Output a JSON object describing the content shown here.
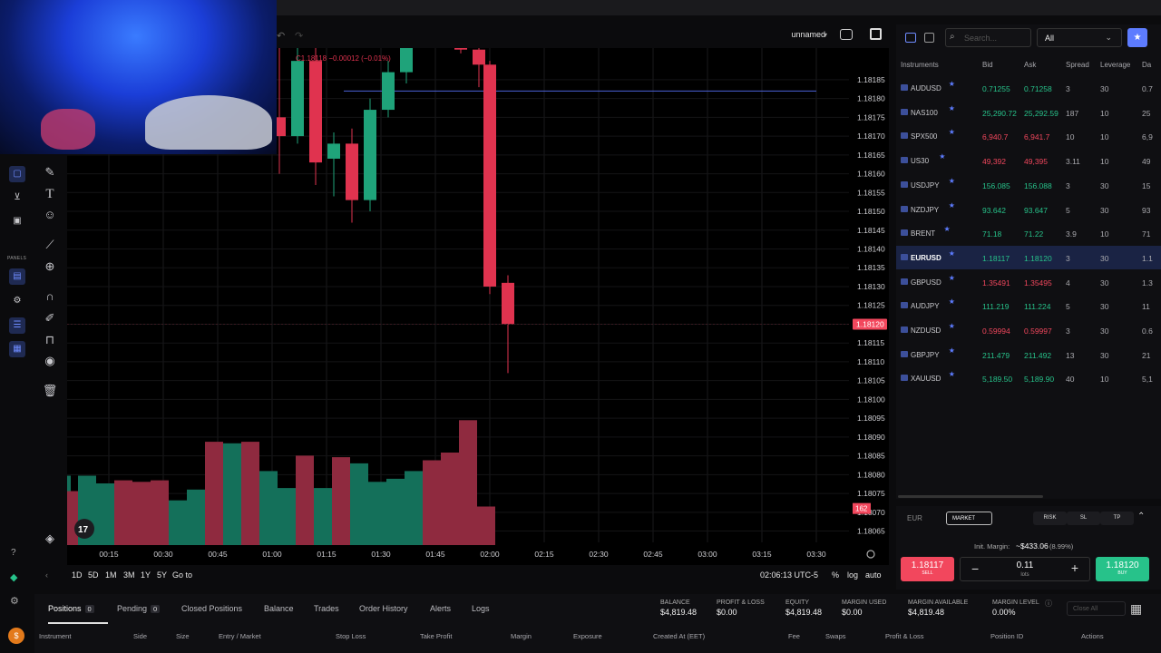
{
  "chart_header": {
    "name": "unnamed",
    "ohlc_text": "C1.18118 −0.00012 (−0.01%)"
  },
  "left_toolbar": {
    "panels_label": "PANELS"
  },
  "timeframes": [
    "1D",
    "5D",
    "1M",
    "3M",
    "1Y",
    "5Y",
    "Go to"
  ],
  "clock": "02:06:13 UTC-5",
  "chart_opts": {
    "percent": "%",
    "log": "log",
    "auto": "auto"
  },
  "chart_data": {
    "type": "candlestick",
    "symbol": "EURUSD",
    "x_ticks": [
      "00:15",
      "00:30",
      "00:45",
      "01:00",
      "01:15",
      "01:30",
      "01:45",
      "02:00",
      "02:15",
      "02:30",
      "02:45",
      "03:00",
      "03:15",
      "03:30"
    ],
    "y_ticks": [
      "1.18185",
      "1.18180",
      "1.18175",
      "1.18170",
      "1.18165",
      "1.18160",
      "1.18155",
      "1.18150",
      "1.18145",
      "1.18140",
      "1.18135",
      "1.18130",
      "1.18125",
      "1.18120",
      "1.18115",
      "1.18110",
      "1.18105",
      "1.18100",
      "1.18095",
      "1.18090",
      "1.18085",
      "1.18080",
      "1.18075",
      "1.18070",
      "1.18065"
    ],
    "ylim": [
      1.18062,
      1.18191
    ],
    "last_price": "1.18120",
    "countdown_label": "162",
    "horizontal_line": 1.18182,
    "candles": [
      {
        "t": "01:02",
        "o": 1.18175,
        "h": 1.18194,
        "l": 1.1816,
        "c": 1.1817
      },
      {
        "t": "01:07",
        "o": 1.1817,
        "h": 1.18194,
        "l": 1.18168,
        "c": 1.1819
      },
      {
        "t": "01:12",
        "o": 1.1819,
        "h": 1.18194,
        "l": 1.18157,
        "c": 1.18163
      },
      {
        "t": "01:17",
        "o": 1.18164,
        "h": 1.18171,
        "l": 1.18154,
        "c": 1.18168
      },
      {
        "t": "01:22",
        "o": 1.18168,
        "h": 1.18172,
        "l": 1.18147,
        "c": 1.18153
      },
      {
        "t": "01:27",
        "o": 1.18153,
        "h": 1.1818,
        "l": 1.1815,
        "c": 1.18177
      },
      {
        "t": "01:32",
        "o": 1.18177,
        "h": 1.1819,
        "l": 1.18175,
        "c": 1.18187
      },
      {
        "t": "01:37",
        "o": 1.18187,
        "h": 1.18198,
        "l": 1.18184,
        "c": 1.18194
      },
      {
        "t": "01:52",
        "o": 1.18194,
        "h": 1.18199,
        "l": 1.18192,
        "c": 1.18193
      },
      {
        "t": "01:57",
        "o": 1.18193,
        "h": 1.18196,
        "l": 1.18183,
        "c": 1.18189
      },
      {
        "t": "02:00",
        "o": 1.18189,
        "h": 1.1819,
        "l": 1.18128,
        "c": 1.1813
      },
      {
        "t": "02:05",
        "o": 1.18131,
        "h": 1.18133,
        "l": 1.18107,
        "c": 1.1812
      }
    ],
    "volume": [
      {
        "t": "00:00",
        "v": 0.45,
        "dir": "up"
      },
      {
        "t": "00:05",
        "v": 0.35,
        "dir": "down"
      },
      {
        "t": "00:10",
        "v": 0.45,
        "dir": "up"
      },
      {
        "t": "00:15",
        "v": 0.4,
        "dir": "up"
      },
      {
        "t": "00:20",
        "v": 0.42,
        "dir": "down"
      },
      {
        "t": "00:25",
        "v": 0.41,
        "dir": "down"
      },
      {
        "t": "00:30",
        "v": 0.42,
        "dir": "down"
      },
      {
        "t": "00:35",
        "v": 0.29,
        "dir": "up"
      },
      {
        "t": "00:40",
        "v": 0.36,
        "dir": "up"
      },
      {
        "t": "00:45",
        "v": 0.67,
        "dir": "down"
      },
      {
        "t": "00:50",
        "v": 0.66,
        "dir": "up"
      },
      {
        "t": "00:55",
        "v": 0.67,
        "dir": "down"
      },
      {
        "t": "01:00",
        "v": 0.48,
        "dir": "up"
      },
      {
        "t": "01:05",
        "v": 0.37,
        "dir": "up"
      },
      {
        "t": "01:10",
        "v": 0.58,
        "dir": "down"
      },
      {
        "t": "01:15",
        "v": 0.37,
        "dir": "up"
      },
      {
        "t": "01:20",
        "v": 0.57,
        "dir": "down"
      },
      {
        "t": "01:25",
        "v": 0.53,
        "dir": "up"
      },
      {
        "t": "01:30",
        "v": 0.41,
        "dir": "up"
      },
      {
        "t": "01:35",
        "v": 0.43,
        "dir": "up"
      },
      {
        "t": "01:40",
        "v": 0.48,
        "dir": "up"
      },
      {
        "t": "01:45",
        "v": 0.55,
        "dir": "down"
      },
      {
        "t": "01:50",
        "v": 0.6,
        "dir": "down"
      },
      {
        "t": "01:55",
        "v": 0.81,
        "dir": "down"
      },
      {
        "t": "02:00",
        "v": 0.25,
        "dir": "down"
      }
    ]
  },
  "instruments_panel": {
    "search_placeholder": "Search...",
    "filter_value": "All",
    "columns": [
      "Instruments",
      "Bid",
      "Ask",
      "Spread",
      "Leverage",
      "Da"
    ],
    "rows": [
      {
        "symbol": "AUDUSD",
        "bid": "0.71255",
        "ask": "0.71258",
        "spread": "3",
        "leverage": "30",
        "extra": "0.7",
        "color": "green"
      },
      {
        "symbol": "NAS100",
        "bid": "25,290.72",
        "ask": "25,292.59",
        "spread": "187",
        "leverage": "10",
        "extra": "25",
        "color": "green"
      },
      {
        "symbol": "SPX500",
        "bid": "6,940.7",
        "ask": "6,941.7",
        "spread": "10",
        "leverage": "10",
        "extra": "6,9",
        "color": "red"
      },
      {
        "symbol": "US30",
        "bid": "49,392",
        "ask": "49,395",
        "spread": "3.11",
        "leverage": "10",
        "extra": "49",
        "color": "red"
      },
      {
        "symbol": "USDJPY",
        "bid": "156.085",
        "ask": "156.088",
        "spread": "3",
        "leverage": "30",
        "extra": "15",
        "color": "green"
      },
      {
        "symbol": "NZDJPY",
        "bid": "93.642",
        "ask": "93.647",
        "spread": "5",
        "leverage": "30",
        "extra": "93",
        "color": "green"
      },
      {
        "symbol": "BRENT",
        "bid": "71.18",
        "ask": "71.22",
        "spread": "3.9",
        "leverage": "10",
        "extra": "71",
        "color": "green"
      },
      {
        "symbol": "EURUSD",
        "bid": "1.18117",
        "ask": "1.18120",
        "spread": "3",
        "leverage": "30",
        "extra": "1.1",
        "color": "green",
        "selected": true
      },
      {
        "symbol": "GBPUSD",
        "bid": "1.35491",
        "ask": "1.35495",
        "spread": "4",
        "leverage": "30",
        "extra": "1.3",
        "color": "red"
      },
      {
        "symbol": "AUDJPY",
        "bid": "111.219",
        "ask": "111.224",
        "spread": "5",
        "leverage": "30",
        "extra": "11",
        "color": "green"
      },
      {
        "symbol": "NZDUSD",
        "bid": "0.59994",
        "ask": "0.59997",
        "spread": "3",
        "leverage": "30",
        "extra": "0.6",
        "color": "red"
      },
      {
        "symbol": "GBPJPY",
        "bid": "211.479",
        "ask": "211.492",
        "spread": "13",
        "leverage": "30",
        "extra": "21",
        "color": "green"
      },
      {
        "symbol": "XAUUSD",
        "bid": "5,189.50",
        "ask": "5,189.90",
        "spread": "40",
        "leverage": "10",
        "extra": "5,1",
        "color": "green"
      }
    ]
  },
  "order_panel": {
    "symbol_short": "EUR",
    "market_label": "MARKET",
    "risk_label": "RISK",
    "sl_label": "SL",
    "tp_label": "TP",
    "init_margin_label": "Init. Margin:",
    "init_margin_value": "~$433.06",
    "init_margin_pct": "(8.99%)",
    "sell_price": "1.18117",
    "sell_label": "SELL",
    "buy_price": "1.18120",
    "buy_label": "BUY",
    "lots_value": "0.11",
    "lots_label": "lots"
  },
  "bottom_panel": {
    "tabs": [
      {
        "label": "Positions",
        "count": "0"
      },
      {
        "label": "Pending",
        "count": "0"
      },
      {
        "label": "Closed Positions"
      },
      {
        "label": "Balance"
      },
      {
        "label": "Trades"
      },
      {
        "label": "Order History"
      },
      {
        "label": "Alerts"
      },
      {
        "label": "Logs"
      }
    ],
    "stats": [
      {
        "label": "BALANCE",
        "value": "$4,819.48"
      },
      {
        "label": "PROFIT & LOSS",
        "value": "$0.00"
      },
      {
        "label": "EQUITY",
        "value": "$4,819.48"
      },
      {
        "label": "MARGIN USED",
        "value": "$0.00"
      },
      {
        "label": "MARGIN AVAILABLE",
        "value": "$4,819.48"
      },
      {
        "label": "MARGIN LEVEL",
        "value": "0.00%"
      }
    ],
    "close_all": "Close All",
    "columns": [
      "Instrument",
      "Side",
      "Size",
      "Entry / Market",
      "Stop Loss",
      "Take Profit",
      "Margin",
      "Exposure",
      "Created At (EET)",
      "Fee",
      "Swaps",
      "Profit & Loss",
      "Position ID",
      "Actions"
    ]
  },
  "colors": {
    "up": "#1fa37a",
    "down": "#e0334f",
    "up_vol": "#14705a",
    "down_vol": "#8f2a3f",
    "accent": "#5d7cff"
  }
}
